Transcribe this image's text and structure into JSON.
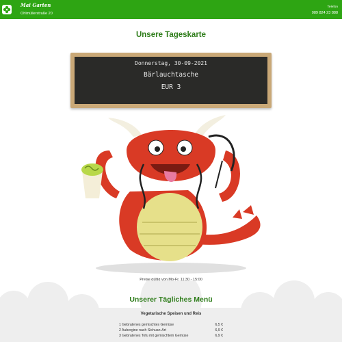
{
  "header": {
    "brand": "Mai Garten",
    "address": "Ohlmüllerstraße 20",
    "phone_label": "Telefon",
    "phone": "089 824 23 888"
  },
  "board_section": {
    "title": "Unsere Tageskarte",
    "date": "Donnerstag, 30-09-2021",
    "dish": "Bärlauchtasche",
    "price": "EUR 3"
  },
  "price_note": "Preise gültig von Mo-Fr. 11:30 - 15:00",
  "menu_section": {
    "title": "Unserer Tägliches Menü",
    "category": "Vegetarische Speisen und Reis",
    "items": [
      {
        "name": "1 Gebratenes gemischtes Gemüse",
        "price": "6,5 €"
      },
      {
        "name": "2 Aubergine nach Sichuan-Art",
        "price": "6,9 €"
      },
      {
        "name": "3 Gebratenes Tofu mit gemischtem Gemüse",
        "price": "6,9 €"
      }
    ]
  },
  "colors": {
    "header_bg": "#2ea513",
    "heading_green": "#2f7d1b",
    "dragon_red": "#d93a25",
    "dragon_yellow": "#e6e08a"
  },
  "icons": [
    "flower-logo-icon"
  ]
}
